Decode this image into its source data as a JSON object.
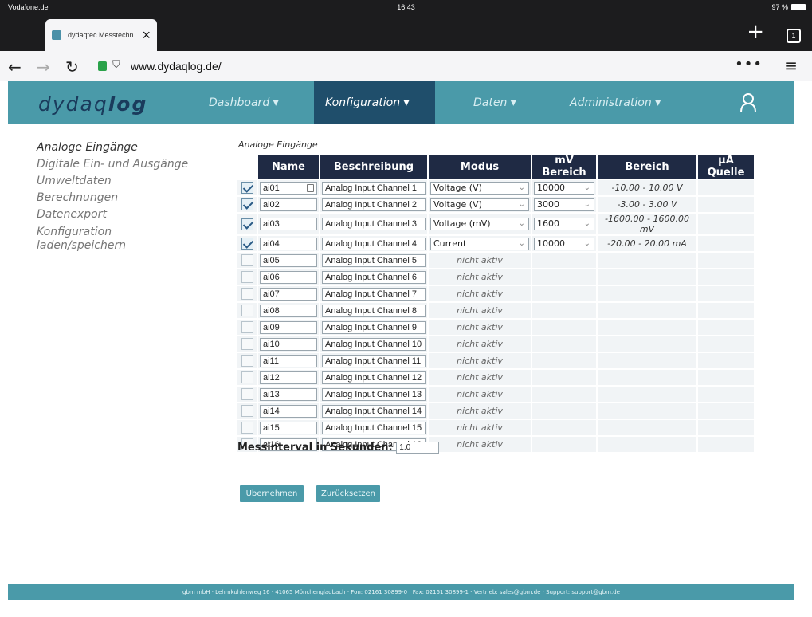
{
  "status_bar": {
    "carrier": "Vodafone.de",
    "time": "16:43",
    "battery": "97 %"
  },
  "browser": {
    "tab_title": "dydaqtec Messtechn",
    "tab_count": "1",
    "url": "www.dydaqlog.de/"
  },
  "nav": {
    "logo_light": "dydaq",
    "logo_bold": "log",
    "items": [
      "Dashboard ▾",
      "Konfiguration ▾",
      "Daten ▾",
      "Administration ▾"
    ]
  },
  "sidebar": {
    "items": [
      "Analoge Eingänge",
      "Digitale Ein- und Ausgänge",
      "Umweltdaten",
      "Berechnungen",
      "Datenexport",
      "Konfiguration",
      "laden/speichern"
    ]
  },
  "section_title": "Analoge Eingänge",
  "table": {
    "headers": [
      "Name",
      "Beschreibung",
      "Modus",
      "mV Bereich",
      "Bereich",
      "µA Quelle"
    ],
    "inactive_label": "nicht aktiv",
    "rows": [
      {
        "name": "ai01",
        "desc": "Analog Input Channel 1",
        "mode": "Voltage (V)",
        "mv": "10000",
        "range": "-10.00 - 10.00 V"
      },
      {
        "name": "ai02",
        "desc": "Analog Input Channel 2",
        "mode": "Voltage (V)",
        "mv": "3000",
        "range": "-3.00 - 3.00 V"
      },
      {
        "name": "ai03",
        "desc": "Analog Input Channel 3",
        "mode": "Voltage (mV)",
        "mv": "1600",
        "range": "-1600.00 - 1600.00 mV"
      },
      {
        "name": "ai04",
        "desc": "Analog Input Channel 4",
        "mode": "Current",
        "mv": "10000",
        "range": "-20.00 - 20.00 mA"
      },
      {
        "name": "ai05",
        "desc": "Analog Input Channel 5"
      },
      {
        "name": "ai06",
        "desc": "Analog Input Channel 6"
      },
      {
        "name": "ai07",
        "desc": "Analog Input Channel 7"
      },
      {
        "name": "ai08",
        "desc": "Analog Input Channel 8"
      },
      {
        "name": "ai09",
        "desc": "Analog Input Channel 9"
      },
      {
        "name": "ai10",
        "desc": "Analog Input Channel 10"
      },
      {
        "name": "ai11",
        "desc": "Analog Input Channel 11"
      },
      {
        "name": "ai12",
        "desc": "Analog Input Channel 12"
      },
      {
        "name": "ai13",
        "desc": "Analog Input Channel 13"
      },
      {
        "name": "ai14",
        "desc": "Analog Input Channel 14"
      },
      {
        "name": "ai15",
        "desc": "Analog Input Channel 15"
      },
      {
        "name": "ai16",
        "desc": "Analog Input Channel 16"
      }
    ]
  },
  "interval": {
    "label": "Messinterval in Sekunden:",
    "value": "1.0"
  },
  "buttons": {
    "apply": "Übernehmen",
    "reset": "Zurücksetzen"
  },
  "footer": "gbm mbH · Lehmkuhlenweg 16 · 41065 Mönchengladbach · Fon: 02161 30899-0 · Fax: 02161 30899-1 · Vertrieb: sales@gbm.de · Support: support@gbm.de",
  "colors": {
    "accent": "#4a9aa9",
    "nav_active": "#1f4e6b",
    "table_header": "#1f2a44"
  }
}
